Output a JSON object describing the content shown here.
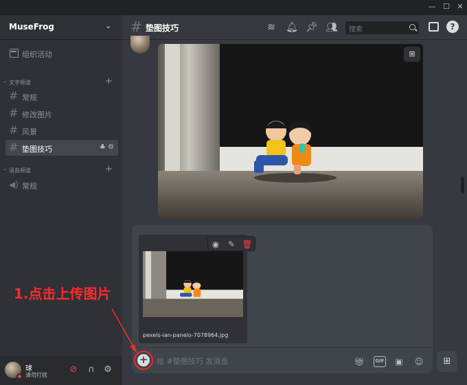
{
  "sidebar": {
    "server_name": "MuseFrog",
    "events_label": "组织活动",
    "text_category": "文字频道",
    "voice_category": "语音频道",
    "text_channels": [
      "常规",
      "修改图片",
      "风景",
      "垫图技巧"
    ],
    "voice_channels": [
      "常规"
    ],
    "user": {
      "name": "球",
      "status": "请勿打扰"
    }
  },
  "header": {
    "channel_name": "垫图技巧",
    "search_placeholder": "搜索"
  },
  "composer": {
    "attachment_name": "pexels-ian-panelo-7078964.jpg",
    "placeholder": "给 #垫图技巧 发消息"
  },
  "annotation": {
    "text": "1.点击上传图片"
  },
  "colors": {
    "accent_red": "#ed4245",
    "annotation_red": "#ff2a2a",
    "sidebar_bg": "#2f3136",
    "main_bg": "#36393f"
  }
}
